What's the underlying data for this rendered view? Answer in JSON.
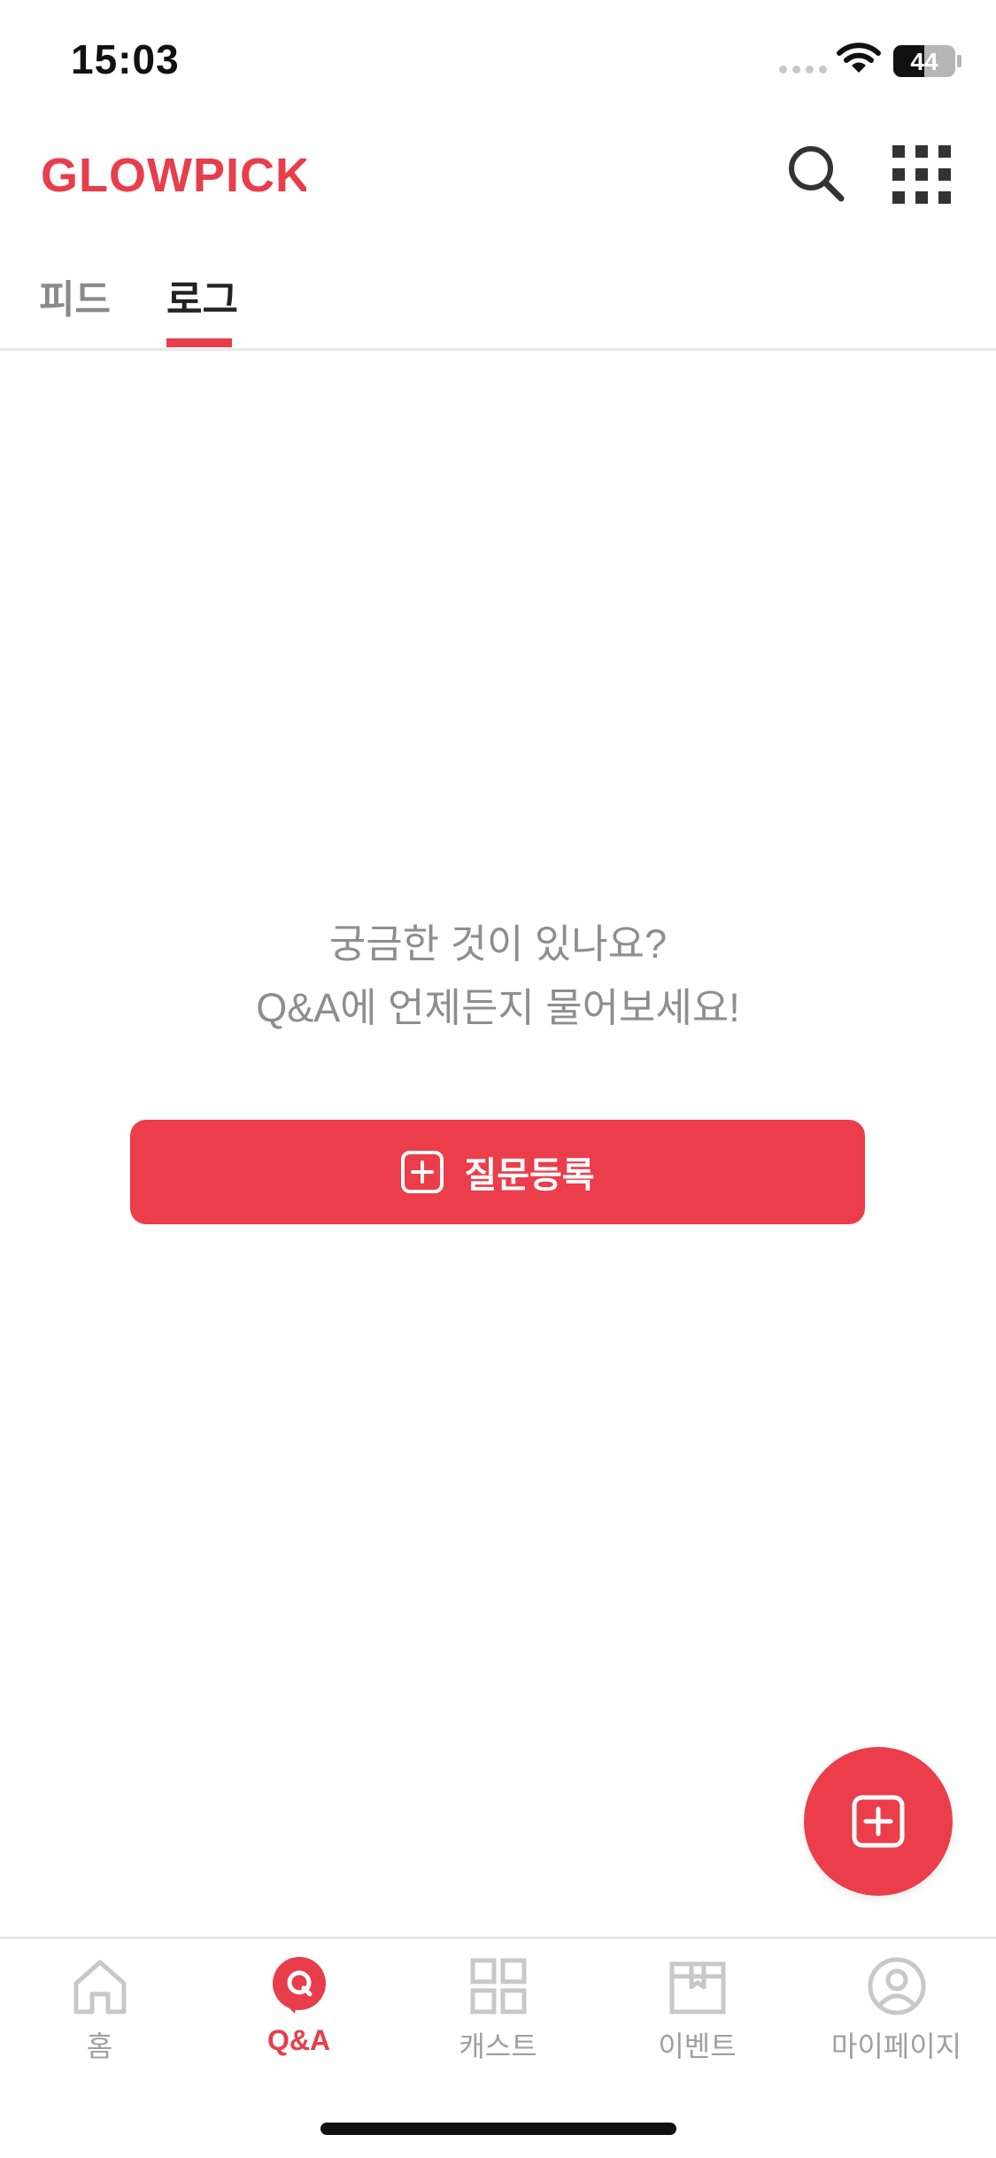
{
  "status_bar": {
    "time": "15:03",
    "battery": "44"
  },
  "header": {
    "logo_text": "GLOWPICK",
    "brand_color": "#e83d4a"
  },
  "tabs": [
    {
      "label": "피드",
      "active": false
    },
    {
      "label": "로그",
      "active": true
    }
  ],
  "empty_state": {
    "line1": "궁금한 것이 있나요?",
    "line2": "Q&A에 언제든지 물어보세요!",
    "button_label": "질문등록"
  },
  "bottom_nav": [
    {
      "label": "홈",
      "icon": "home-icon",
      "active": false
    },
    {
      "label": "Q&A",
      "icon": "qna-icon",
      "active": true
    },
    {
      "label": "캐스트",
      "icon": "cast-grid-icon",
      "active": false
    },
    {
      "label": "이벤트",
      "icon": "event-box-icon",
      "active": false
    },
    {
      "label": "마이페이지",
      "icon": "profile-icon",
      "active": false
    }
  ],
  "colors": {
    "accent": "#eb3d4a",
    "inactive": "#a0a0a0",
    "text_gray": "#8e8e8e"
  }
}
